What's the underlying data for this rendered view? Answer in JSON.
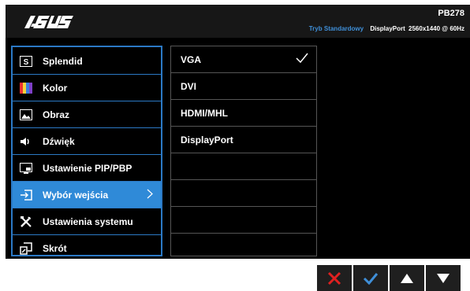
{
  "header": {
    "brand": "ASUS",
    "model": "PB278",
    "mode": "Tryb Standardowy",
    "input": "DisplayPort",
    "resolution": "2560x1440 @ 60Hz"
  },
  "menu": {
    "items": [
      {
        "label": "Splendid",
        "icon": "splendid-icon"
      },
      {
        "label": "Kolor",
        "icon": "color-icon"
      },
      {
        "label": "Obraz",
        "icon": "image-icon"
      },
      {
        "label": "Dźwięk",
        "icon": "speaker-icon"
      },
      {
        "label": "Ustawienie PIP/PBP",
        "icon": "pip-icon"
      },
      {
        "label": "Wybór wejścia",
        "icon": "input-select-icon",
        "selected": true
      },
      {
        "label": "Ustawienia systemu",
        "icon": "tools-icon"
      },
      {
        "label": "Skrót",
        "icon": "shortcut-icon"
      }
    ]
  },
  "submenu": {
    "items": [
      {
        "label": "VGA",
        "checked": true
      },
      {
        "label": "DVI"
      },
      {
        "label": "HDMI/MHL"
      },
      {
        "label": "DisplayPort"
      },
      {
        "label": ""
      },
      {
        "label": ""
      },
      {
        "label": ""
      },
      {
        "label": ""
      }
    ]
  },
  "keys": [
    "close-icon",
    "confirm-icon",
    "up-arrow-icon",
    "down-arrow-icon"
  ],
  "colors": {
    "accent": "#2f8ad8",
    "close": "#e02020",
    "confirm": "#3f8fd8"
  }
}
